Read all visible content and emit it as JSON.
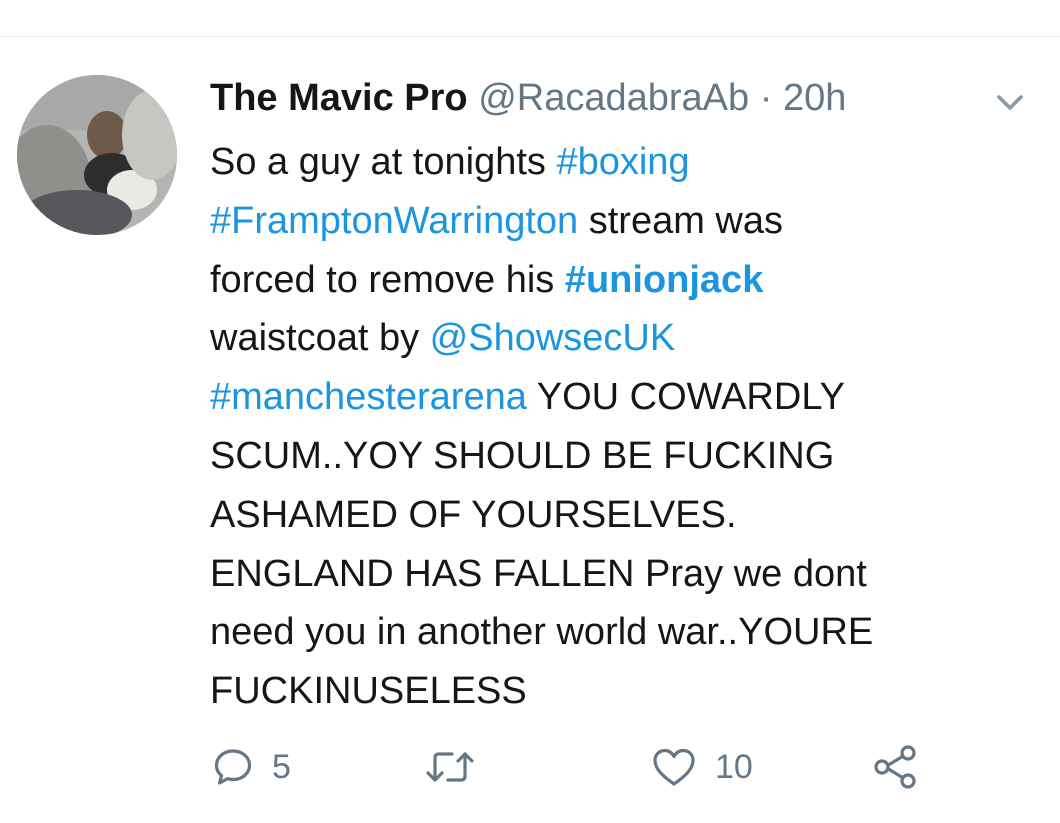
{
  "tweet": {
    "display_name": "The Mavic Pro",
    "handle": "@RacadabraAb",
    "separator": "·",
    "time": "20h",
    "lines": [
      [
        {
          "t": "So a guy at tonights ",
          "k": "text"
        },
        {
          "t": "#boxing",
          "k": "hashtag"
        }
      ],
      [
        {
          "t": "#FramptonWarrington",
          "k": "hashtag"
        },
        {
          "t": " stream was",
          "k": "text"
        }
      ],
      [
        {
          "t": "forced to remove his ",
          "k": "text"
        },
        {
          "t": "#unionjack",
          "k": "hashtag-bold"
        }
      ],
      [
        {
          "t": "waistcoat by ",
          "k": "text"
        },
        {
          "t": "@ShowsecUK",
          "k": "mention"
        }
      ],
      [
        {
          "t": "#manchesterarena",
          "k": "hashtag"
        },
        {
          "t": " YOU COWARDLY",
          "k": "text"
        }
      ],
      [
        {
          "t": "SCUM..YOY SHOULD BE FUCKING",
          "k": "text"
        }
      ],
      [
        {
          "t": "ASHAMED OF YOURSELVES.",
          "k": "text"
        }
      ],
      [
        {
          "t": "ENGLAND HAS FALLEN Pray we dont",
          "k": "text"
        }
      ],
      [
        {
          "t": "need you in another world war..YOURE",
          "k": "text"
        }
      ],
      [
        {
          "t": "FUCKINUSELESS",
          "k": "text"
        }
      ]
    ],
    "actions": {
      "reply_count": "5",
      "like_count": "10"
    }
  },
  "icons": {
    "avatar": "avatar",
    "menu": "chevron-down-icon",
    "reply": "reply-icon",
    "retweet": "retweet-icon",
    "like": "heart-icon",
    "share": "share-icon"
  },
  "colors": {
    "link": "#1b95e0",
    "secondary": "#657786",
    "text": "#14171a",
    "divider": "#e6ecf0"
  }
}
